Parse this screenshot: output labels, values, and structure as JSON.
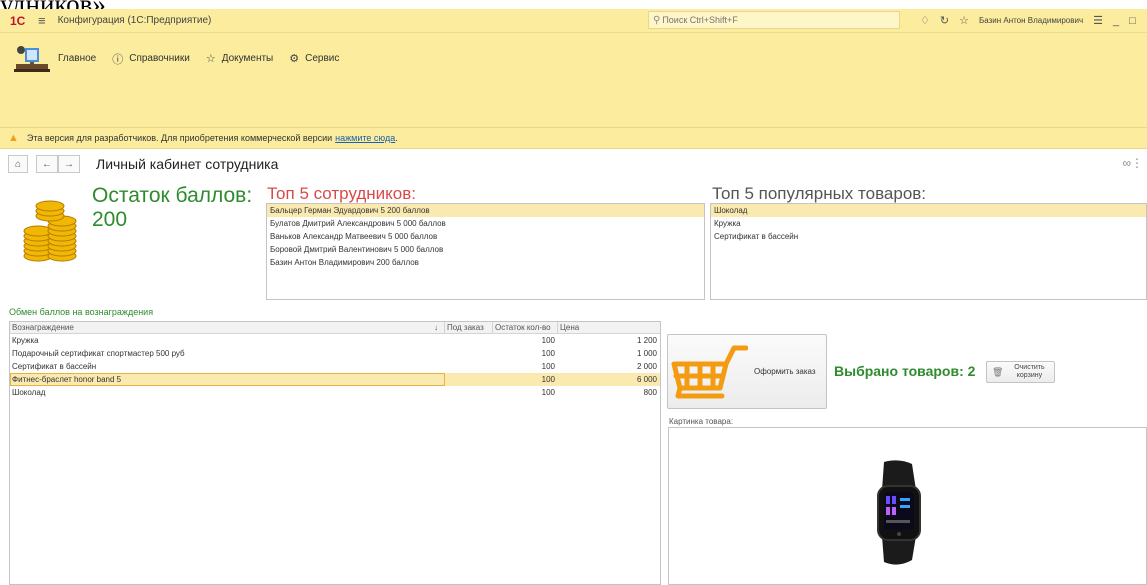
{
  "clipped_text": "удников».",
  "window": {
    "logo": "1С",
    "title": "Конфигурация (1С:Предприятие)",
    "search_placeholder": "Поиск Ctrl+Shift+F",
    "user": "Базин Антон Владимирович"
  },
  "sections": [
    {
      "label": "Главное",
      "icon": "home-icon"
    },
    {
      "label": "Справочники",
      "icon": "info-icon"
    },
    {
      "label": "Документы",
      "icon": "star-icon"
    },
    {
      "label": "Сервис",
      "icon": "gear-icon"
    }
  ],
  "warning": {
    "text": "Эта версия для разработчиков. Для приобретения коммерческой версии",
    "link": "нажмите сюда",
    "tail": "."
  },
  "page_title": "Личный кабинет сотрудника",
  "balance": {
    "label": "Остаток баллов:",
    "value": "200"
  },
  "top_employees": {
    "title": "Топ 5 сотрудников:",
    "items": [
      "Бальцер Герман Эдуардович  5 200 баллов",
      "Булатов Дмитрий Александрович  5 000 баллов",
      "Ваньков Александр Матвеевич 5 000 баллов",
      "Боровой Дмитрий Валентинович   5 000 баллов",
      "Базин Антон Владимирович   200 баллов"
    ]
  },
  "top_products": {
    "title": "Топ 5 популярных товаров:",
    "items": [
      "Шоколад",
      "Кружка",
      "Сертификат в бассейн"
    ]
  },
  "exchange": {
    "title": "Обмен баллов на вознаграждения",
    "columns": [
      "Вознаграждение",
      "Под заказ",
      "Остаток кол-во",
      "Цена"
    ],
    "sort_indicator": "↓",
    "rows": [
      {
        "name": "Кружка",
        "order": "",
        "stock": "100",
        "price": "1 200"
      },
      {
        "name": "Подарочный сертификат спортмастер 500 руб",
        "order": "",
        "stock": "100",
        "price": "1 000"
      },
      {
        "name": "Сертификат в бассейн",
        "order": "",
        "stock": "100",
        "price": "2 000"
      },
      {
        "name": "Фитнес-браслет honor band 5",
        "order": "",
        "stock": "100",
        "price": "6 000"
      },
      {
        "name": "Шоколад",
        "order": "",
        "stock": "100",
        "price": "800"
      }
    ],
    "selected_row": 3
  },
  "order_button": "Оформить заказ",
  "selected_text": "Выбрано товаров: 2",
  "clear_button": "Очистить корзину",
  "picture_label": "Картинка товара:",
  "colors": {
    "header_yellow": "#fbec9e",
    "accent_green": "#2e8b2e",
    "accent_red": "#d84a4a",
    "cart_orange": "#f39c12",
    "selection": "#fbeab0"
  }
}
